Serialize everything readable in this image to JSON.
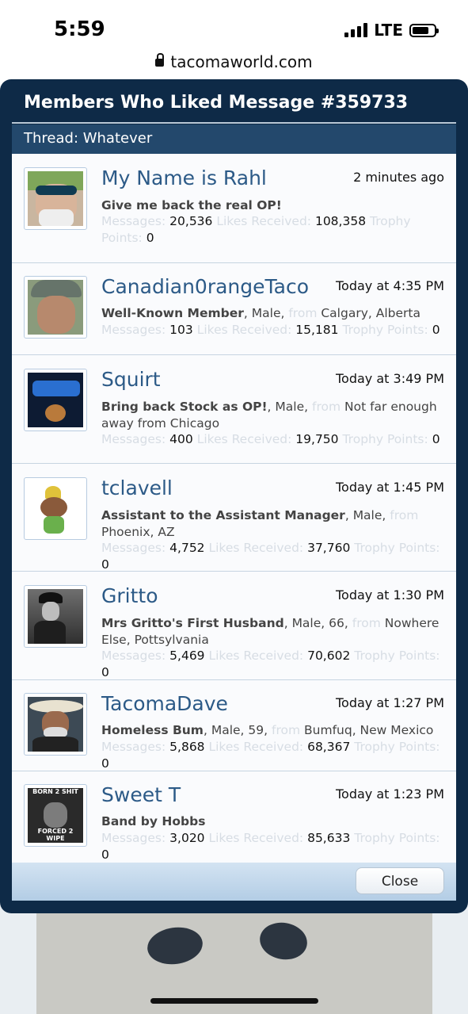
{
  "status": {
    "time": "5:59",
    "network": "LTE"
  },
  "browser": {
    "url": "tacomaworld.com"
  },
  "dialog": {
    "title": "Members Who Liked Message #359733",
    "thread_label": "Thread: Whatever",
    "close_label": "Close",
    "members": [
      {
        "name": "My Name is Rahl",
        "time": "2 minutes ago",
        "title": "Give me back the real OP!",
        "gender": "",
        "age": "",
        "location": "",
        "messages": "20,536",
        "likes": "108,358",
        "trophy": "0"
      },
      {
        "name": "Canadian0rangeTaco",
        "time": "Today at 4:35 PM",
        "title": "Well-Known Member",
        "gender": "Male",
        "age": "",
        "location": "Calgary, Alberta",
        "messages": "103",
        "likes": "15,181",
        "trophy": "0"
      },
      {
        "name": "Squirt",
        "time": "Today at 3:49 PM",
        "title": "Bring back Stock as OP!",
        "gender": "Male",
        "age": "",
        "location": "Not far enough away from Chicago",
        "messages": "400",
        "likes": "19,750",
        "trophy": "0"
      },
      {
        "name": "tclavell",
        "time": "Today at 1:45 PM",
        "title": "Assistant to the Assistant Manager",
        "gender": "Male",
        "age": "",
        "location": "Phoenix, AZ",
        "messages": "4,752",
        "likes": "37,760",
        "trophy": "0"
      },
      {
        "name": "Gritto",
        "time": "Today at 1:30 PM",
        "title": "Mrs Gritto's First Husband",
        "gender": "Male",
        "age": "66",
        "location": "Nowhere Else, Pottsylvania",
        "messages": "5,469",
        "likes": "70,602",
        "trophy": "0"
      },
      {
        "name": "TacomaDave",
        "time": "Today at 1:27 PM",
        "title": "Homeless Bum",
        "gender": "Male",
        "age": "59",
        "location": "Bumfuq, New Mexico",
        "messages": "5,868",
        "likes": "68,367",
        "trophy": "0"
      },
      {
        "name": "Sweet T",
        "time": "Today at 1:23 PM",
        "title": "Band by Hobbs",
        "gender": "",
        "age": "",
        "location": "",
        "messages": "3,020",
        "likes": "85,633",
        "trophy": "0"
      }
    ]
  },
  "labels": {
    "from": "from",
    "messages": "Messages:",
    "likes": "Likes Received:",
    "trophy": "Trophy Points:"
  },
  "avatars": {
    "avatar_5": {
      "top_text": "BORN 2 SHIT",
      "bottom_text": "FORCED 2 WIPE"
    }
  },
  "colors": {
    "header_bg": "#0e2a47",
    "thread_bar": "#23486c",
    "name_link": "#2c5a87",
    "faint_label": "#d7dde4"
  }
}
